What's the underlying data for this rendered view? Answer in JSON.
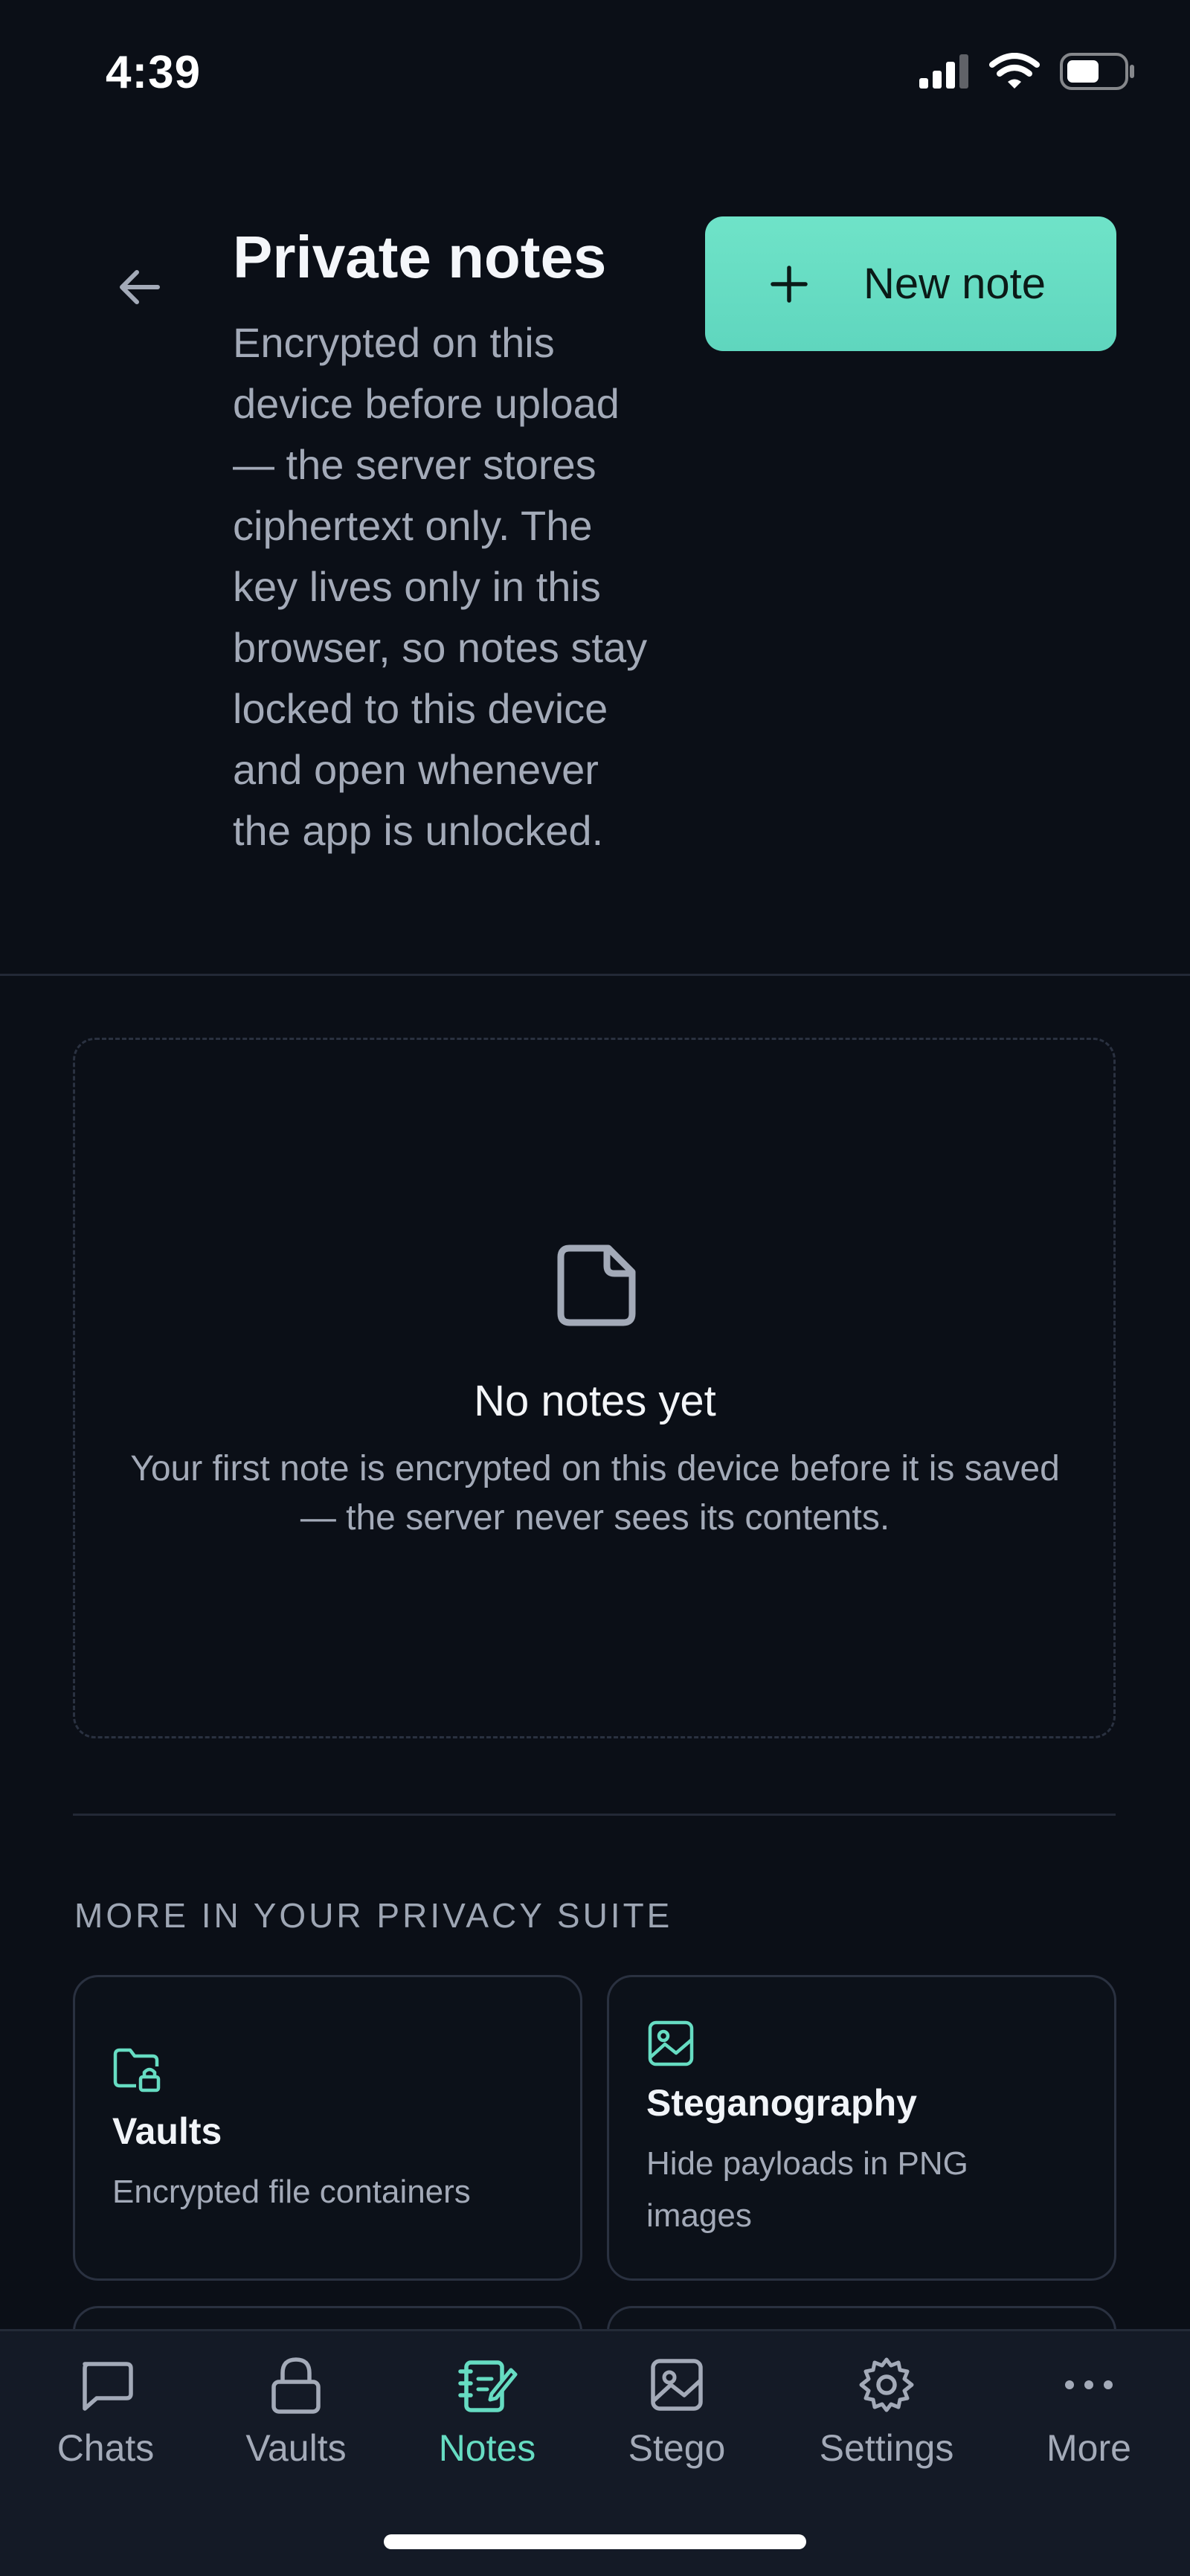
{
  "status_bar": {
    "time": "4:39"
  },
  "header": {
    "title": "Private notes",
    "description": "Encrypted on this device before upload — the server stores ciphertext only. The key lives only in this browser, so notes stay locked to this device and open whenever the app is unlocked.",
    "new_note_label": "New note"
  },
  "empty_state": {
    "icon": "note-icon",
    "title": "No notes yet",
    "description": "Your first note is encrypted on this device before it is saved — the server never sees its contents."
  },
  "suite": {
    "heading": "MORE IN YOUR PRIVACY SUITE",
    "cards": [
      {
        "icon": "folder-lock-icon",
        "title": "Vaults",
        "description": "Encrypted file containers"
      },
      {
        "icon": "image-icon",
        "title": "Steganography",
        "description": "Hide payloads in PNG images"
      }
    ]
  },
  "bottom_nav": {
    "items": [
      {
        "label": "Chats",
        "icon": "chat-icon"
      },
      {
        "label": "Vaults",
        "icon": "lock-icon"
      },
      {
        "label": "Notes",
        "icon": "notebook-icon",
        "active": true
      },
      {
        "label": "Stego",
        "icon": "image-icon"
      },
      {
        "label": "Settings",
        "icon": "gear-icon"
      },
      {
        "label": "More",
        "icon": "more-icon"
      }
    ]
  },
  "colors": {
    "accent": "#66dcc2",
    "background": "#0b0f17",
    "nav_background": "#141a26"
  }
}
